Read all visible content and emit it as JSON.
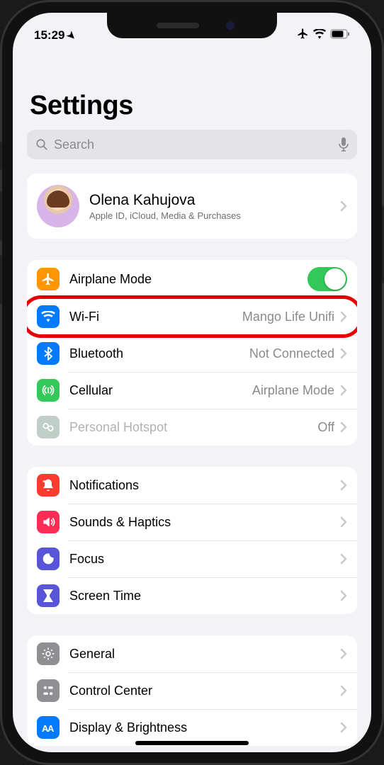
{
  "status": {
    "time": "15:29",
    "airplane": true,
    "wifi": true,
    "battery_level": "three-quarters"
  },
  "title": "Settings",
  "search": {
    "placeholder": "Search"
  },
  "profile": {
    "name": "Olena Kahujova",
    "subtitle": "Apple ID, iCloud, Media & Purchases"
  },
  "groups": [
    {
      "id": "connectivity",
      "items": [
        {
          "icon": "airplane-icon",
          "color": "bg-orange",
          "label": "Airplane Mode",
          "accessory": "toggle-on"
        },
        {
          "icon": "wifi-icon",
          "color": "bg-blue",
          "label": "Wi-Fi",
          "detail": "Mango Life Unifi",
          "accessory": "disclosure",
          "highlighted": true
        },
        {
          "icon": "bluetooth-icon",
          "color": "bg-blue",
          "label": "Bluetooth",
          "detail": "Not Connected",
          "accessory": "disclosure"
        },
        {
          "icon": "cellular-icon",
          "color": "bg-green",
          "label": "Cellular",
          "detail": "Airplane Mode",
          "accessory": "disclosure"
        },
        {
          "icon": "hotspot-icon",
          "color": "bg-greylight",
          "label": "Personal Hotspot",
          "detail": "Off",
          "accessory": "disclosure",
          "disabled": true
        }
      ]
    },
    {
      "id": "attention",
      "items": [
        {
          "icon": "notifications-icon",
          "color": "bg-red",
          "label": "Notifications",
          "accessory": "disclosure"
        },
        {
          "icon": "sounds-icon",
          "color": "bg-pink",
          "label": "Sounds & Haptics",
          "accessory": "disclosure"
        },
        {
          "icon": "focus-icon",
          "color": "bg-indigo",
          "label": "Focus",
          "accessory": "disclosure"
        },
        {
          "icon": "screentime-icon",
          "color": "bg-indigo",
          "label": "Screen Time",
          "accessory": "disclosure"
        }
      ]
    },
    {
      "id": "general-group",
      "items": [
        {
          "icon": "general-icon",
          "color": "bg-grey",
          "label": "General",
          "accessory": "disclosure"
        },
        {
          "icon": "controlcenter-icon",
          "color": "bg-grey",
          "label": "Control Center",
          "accessory": "disclosure"
        },
        {
          "icon": "display-icon",
          "color": "bg-blue2",
          "label": "Display & Brightness",
          "accessory": "disclosure"
        }
      ]
    }
  ]
}
